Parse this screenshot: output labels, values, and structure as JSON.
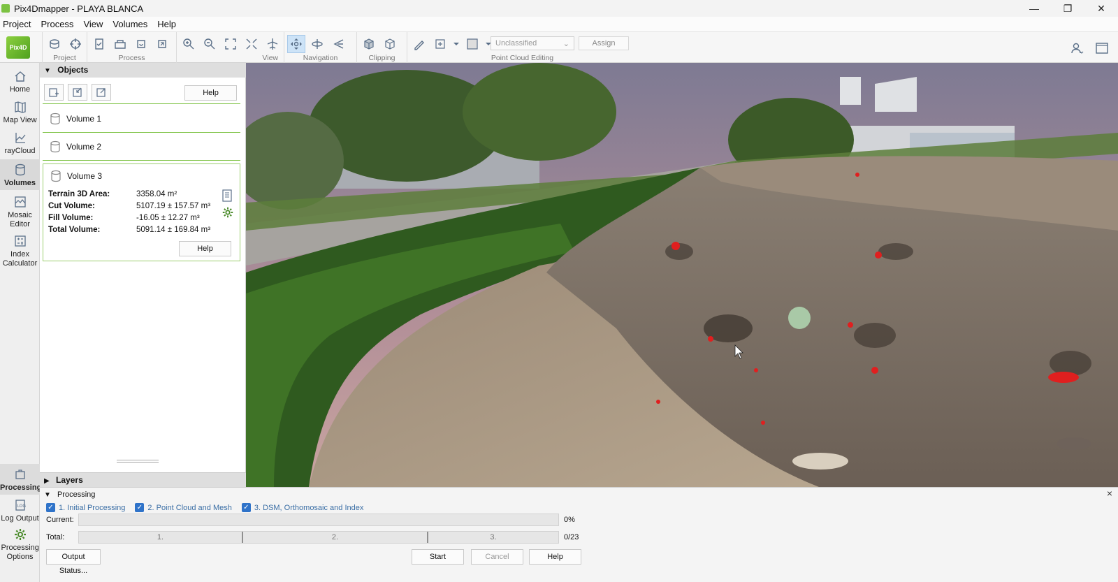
{
  "window": {
    "title": "Pix4Dmapper - PLAYA BLANCA"
  },
  "menu": [
    "Project",
    "Process",
    "View",
    "Volumes",
    "Help"
  ],
  "toolbar": {
    "logo_text": "Pix4D",
    "groups": [
      "Project",
      "Process",
      "View",
      "Navigation",
      "Clipping",
      "Point Cloud Editing"
    ],
    "classification_dropdown": "Unclassified",
    "assign_label": "Assign"
  },
  "sidebar": {
    "items": [
      "Home",
      "Map View",
      "rayCloud",
      "Volumes",
      "Mosaic Editor",
      "Index Calculator",
      "Processing",
      "Log Output",
      "Processing Options"
    ]
  },
  "objects_panel": {
    "header": "Objects",
    "help_label": "Help",
    "volumes": [
      "Volume 1",
      "Volume 2",
      "Volume 3"
    ],
    "expanded": {
      "name": "Volume 3",
      "stats": [
        {
          "label": "Terrain 3D Area:",
          "value": "3358.04 m²"
        },
        {
          "label": "Cut Volume:",
          "value": "5107.19 ± 157.57 m³"
        },
        {
          "label": "Fill Volume:",
          "value": "-16.05 ± 12.27 m³"
        },
        {
          "label": "Total Volume:",
          "value": "5091.14 ± 169.84 m³"
        }
      ],
      "help_label": "Help"
    }
  },
  "layers_panel": {
    "header": "Layers"
  },
  "processing": {
    "header": "Processing",
    "steps": [
      "1. Initial Processing",
      "2. Point Cloud and Mesh",
      "3. DSM, Orthomosaic and Index"
    ],
    "current_label": "Current:",
    "current_value": "0%",
    "total_label": "Total:",
    "total_segments": [
      "1.",
      "2.",
      "3."
    ],
    "total_value": "0/23",
    "output_status_label": "Output Status...",
    "start_label": "Start",
    "cancel_label": "Cancel",
    "help_label": "Help"
  }
}
